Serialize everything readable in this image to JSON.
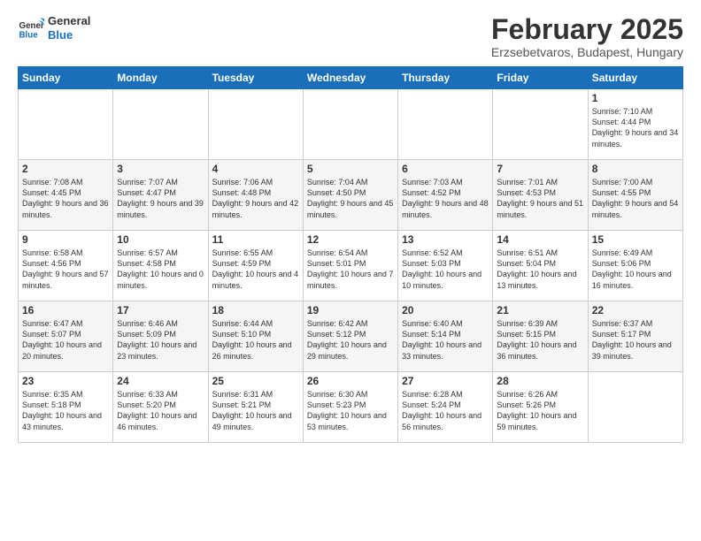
{
  "header": {
    "logo_line1": "General",
    "logo_line2": "Blue",
    "month_title": "February 2025",
    "subtitle": "Erzsebetvaros, Budapest, Hungary"
  },
  "days_of_week": [
    "Sunday",
    "Monday",
    "Tuesday",
    "Wednesday",
    "Thursday",
    "Friday",
    "Saturday"
  ],
  "weeks": [
    [
      {
        "day": "",
        "info": ""
      },
      {
        "day": "",
        "info": ""
      },
      {
        "day": "",
        "info": ""
      },
      {
        "day": "",
        "info": ""
      },
      {
        "day": "",
        "info": ""
      },
      {
        "day": "",
        "info": ""
      },
      {
        "day": "1",
        "info": "Sunrise: 7:10 AM\nSunset: 4:44 PM\nDaylight: 9 hours and 34 minutes."
      }
    ],
    [
      {
        "day": "2",
        "info": "Sunrise: 7:08 AM\nSunset: 4:45 PM\nDaylight: 9 hours and 36 minutes."
      },
      {
        "day": "3",
        "info": "Sunrise: 7:07 AM\nSunset: 4:47 PM\nDaylight: 9 hours and 39 minutes."
      },
      {
        "day": "4",
        "info": "Sunrise: 7:06 AM\nSunset: 4:48 PM\nDaylight: 9 hours and 42 minutes."
      },
      {
        "day": "5",
        "info": "Sunrise: 7:04 AM\nSunset: 4:50 PM\nDaylight: 9 hours and 45 minutes."
      },
      {
        "day": "6",
        "info": "Sunrise: 7:03 AM\nSunset: 4:52 PM\nDaylight: 9 hours and 48 minutes."
      },
      {
        "day": "7",
        "info": "Sunrise: 7:01 AM\nSunset: 4:53 PM\nDaylight: 9 hours and 51 minutes."
      },
      {
        "day": "8",
        "info": "Sunrise: 7:00 AM\nSunset: 4:55 PM\nDaylight: 9 hours and 54 minutes."
      }
    ],
    [
      {
        "day": "9",
        "info": "Sunrise: 6:58 AM\nSunset: 4:56 PM\nDaylight: 9 hours and 57 minutes."
      },
      {
        "day": "10",
        "info": "Sunrise: 6:57 AM\nSunset: 4:58 PM\nDaylight: 10 hours and 0 minutes."
      },
      {
        "day": "11",
        "info": "Sunrise: 6:55 AM\nSunset: 4:59 PM\nDaylight: 10 hours and 4 minutes."
      },
      {
        "day": "12",
        "info": "Sunrise: 6:54 AM\nSunset: 5:01 PM\nDaylight: 10 hours and 7 minutes."
      },
      {
        "day": "13",
        "info": "Sunrise: 6:52 AM\nSunset: 5:03 PM\nDaylight: 10 hours and 10 minutes."
      },
      {
        "day": "14",
        "info": "Sunrise: 6:51 AM\nSunset: 5:04 PM\nDaylight: 10 hours and 13 minutes."
      },
      {
        "day": "15",
        "info": "Sunrise: 6:49 AM\nSunset: 5:06 PM\nDaylight: 10 hours and 16 minutes."
      }
    ],
    [
      {
        "day": "16",
        "info": "Sunrise: 6:47 AM\nSunset: 5:07 PM\nDaylight: 10 hours and 20 minutes."
      },
      {
        "day": "17",
        "info": "Sunrise: 6:46 AM\nSunset: 5:09 PM\nDaylight: 10 hours and 23 minutes."
      },
      {
        "day": "18",
        "info": "Sunrise: 6:44 AM\nSunset: 5:10 PM\nDaylight: 10 hours and 26 minutes."
      },
      {
        "day": "19",
        "info": "Sunrise: 6:42 AM\nSunset: 5:12 PM\nDaylight: 10 hours and 29 minutes."
      },
      {
        "day": "20",
        "info": "Sunrise: 6:40 AM\nSunset: 5:14 PM\nDaylight: 10 hours and 33 minutes."
      },
      {
        "day": "21",
        "info": "Sunrise: 6:39 AM\nSunset: 5:15 PM\nDaylight: 10 hours and 36 minutes."
      },
      {
        "day": "22",
        "info": "Sunrise: 6:37 AM\nSunset: 5:17 PM\nDaylight: 10 hours and 39 minutes."
      }
    ],
    [
      {
        "day": "23",
        "info": "Sunrise: 6:35 AM\nSunset: 5:18 PM\nDaylight: 10 hours and 43 minutes."
      },
      {
        "day": "24",
        "info": "Sunrise: 6:33 AM\nSunset: 5:20 PM\nDaylight: 10 hours and 46 minutes."
      },
      {
        "day": "25",
        "info": "Sunrise: 6:31 AM\nSunset: 5:21 PM\nDaylight: 10 hours and 49 minutes."
      },
      {
        "day": "26",
        "info": "Sunrise: 6:30 AM\nSunset: 5:23 PM\nDaylight: 10 hours and 53 minutes."
      },
      {
        "day": "27",
        "info": "Sunrise: 6:28 AM\nSunset: 5:24 PM\nDaylight: 10 hours and 56 minutes."
      },
      {
        "day": "28",
        "info": "Sunrise: 6:26 AM\nSunset: 5:26 PM\nDaylight: 10 hours and 59 minutes."
      },
      {
        "day": "",
        "info": ""
      }
    ]
  ]
}
